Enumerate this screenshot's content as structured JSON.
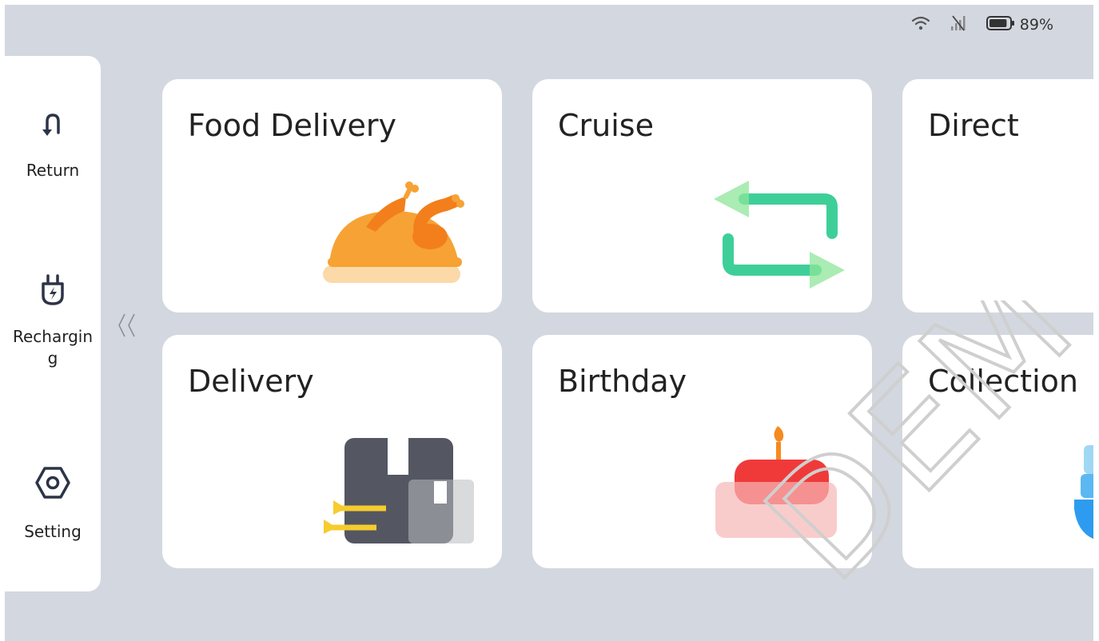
{
  "status_bar": {
    "battery_percent": "89%",
    "battery_level": 0.89,
    "icons": [
      "wifi-icon",
      "no-signal-icon",
      "battery-icon"
    ]
  },
  "sidebar": {
    "items": [
      {
        "label": "Return",
        "icon": "return-icon"
      },
      {
        "label": "Rechargin g",
        "icon": "charging-plug-icon"
      },
      {
        "label": "Setting",
        "icon": "settings-hex-icon"
      }
    ]
  },
  "collapse": {
    "icon": "double-chevron-left-icon"
  },
  "cards": [
    {
      "title": "Food Delivery",
      "icon": "roast-chicken-icon"
    },
    {
      "title": "Cruise",
      "icon": "loop-arrows-icon"
    },
    {
      "title": "Direct",
      "icon": ""
    },
    {
      "title": "Delivery",
      "icon": "package-box-icon"
    },
    {
      "title": "Birthday",
      "icon": "birthday-cake-icon"
    },
    {
      "title": "Collection",
      "icon": "stacked-bowls-icon"
    }
  ],
  "watermark": {
    "text": "DEMY"
  },
  "colors": {
    "background": "#d3d7e0",
    "card": "#ffffff",
    "accent_green": "#3ecf99",
    "accent_orange": "#f7a234",
    "accent_red": "#f03a3a",
    "box_dark": "#545762",
    "accent_yellow": "#f6cc2e",
    "accent_blue": "#2d9cf0"
  }
}
